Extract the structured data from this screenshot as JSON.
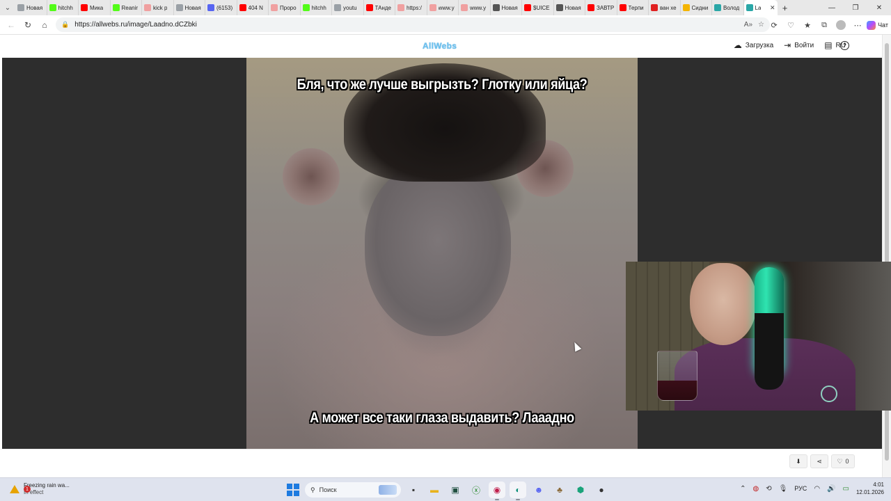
{
  "browser": {
    "tabs": [
      {
        "title": "Новая",
        "favicon": "page-icon",
        "color": "#9aa0a6"
      },
      {
        "title": "hitchh",
        "favicon": "kick-icon",
        "color": "#53fc18"
      },
      {
        "title": "Мика",
        "favicon": "youtube-icon",
        "color": "#ff0000"
      },
      {
        "title": "Reanir",
        "favicon": "kick-icon",
        "color": "#53fc18"
      },
      {
        "title": "kick p",
        "favicon": "yandex-icon",
        "color": "#f0a0a0"
      },
      {
        "title": "Новая",
        "favicon": "page-icon",
        "color": "#9aa0a6"
      },
      {
        "title": "(6153)",
        "favicon": "discord-icon",
        "color": "#5865f2"
      },
      {
        "title": "404 N",
        "favicon": "youtube-icon",
        "color": "#ff0000"
      },
      {
        "title": "Проро",
        "favicon": "yandex-icon",
        "color": "#f0a0a0"
      },
      {
        "title": "hitchh",
        "favicon": "kick-icon",
        "color": "#53fc18"
      },
      {
        "title": "youtu",
        "favicon": "page-icon",
        "color": "#9aa0a6"
      },
      {
        "title": "ТАнде",
        "favicon": "youtube-icon",
        "color": "#ff0000"
      },
      {
        "title": "https:/",
        "favicon": "yandex-icon",
        "color": "#f0a0a0"
      },
      {
        "title": "www.y",
        "favicon": "yandex-icon",
        "color": "#f0a0a0"
      },
      {
        "title": "www.y",
        "favicon": "yandex-icon",
        "color": "#f0a0a0"
      },
      {
        "title": "Новая",
        "favicon": "page-icon",
        "color": "#555555"
      },
      {
        "title": "$UICE",
        "favicon": "youtube-icon",
        "color": "#ff0000"
      },
      {
        "title": "Новая",
        "favicon": "page-icon",
        "color": "#555555"
      },
      {
        "title": "ЗАВТР",
        "favicon": "youtube-icon",
        "color": "#ff0000"
      },
      {
        "title": "Терпи",
        "favicon": "youtube-icon",
        "color": "#ff0000"
      },
      {
        "title": "ван хе",
        "favicon": "yandex-icon",
        "color": "#e02020"
      },
      {
        "title": "Сидни",
        "favicon": "drive-icon",
        "color": "#f4b400"
      },
      {
        "title": "Волод",
        "favicon": "globe-icon",
        "color": "#2aa7a7"
      },
      {
        "title": "La",
        "favicon": "globe-icon",
        "color": "#2aa7a7",
        "active": true
      }
    ],
    "new_tab": "+",
    "url": "https://allwebs.ru/image/Laadno.dCZbki",
    "copilot_label": "Чат"
  },
  "site": {
    "logo": "AllWebs",
    "nav": {
      "upload": "Загрузка",
      "login": "Войти",
      "lang": "RU",
      "help": "?"
    }
  },
  "image": {
    "top_caption": "Бля, что же лучше выгрызть? Глотку или яйца?",
    "bottom_caption": "А может все таки глаза выдавить? Лааадно"
  },
  "actions": {
    "like_count": "0"
  },
  "taskbar": {
    "weather_title": "Freezing rain wa...",
    "weather_sub": "In effect",
    "weather_badge": "1",
    "search_placeholder": "Поиск",
    "lang": "РУС",
    "time": "4:01",
    "date": "12.01.2026"
  }
}
